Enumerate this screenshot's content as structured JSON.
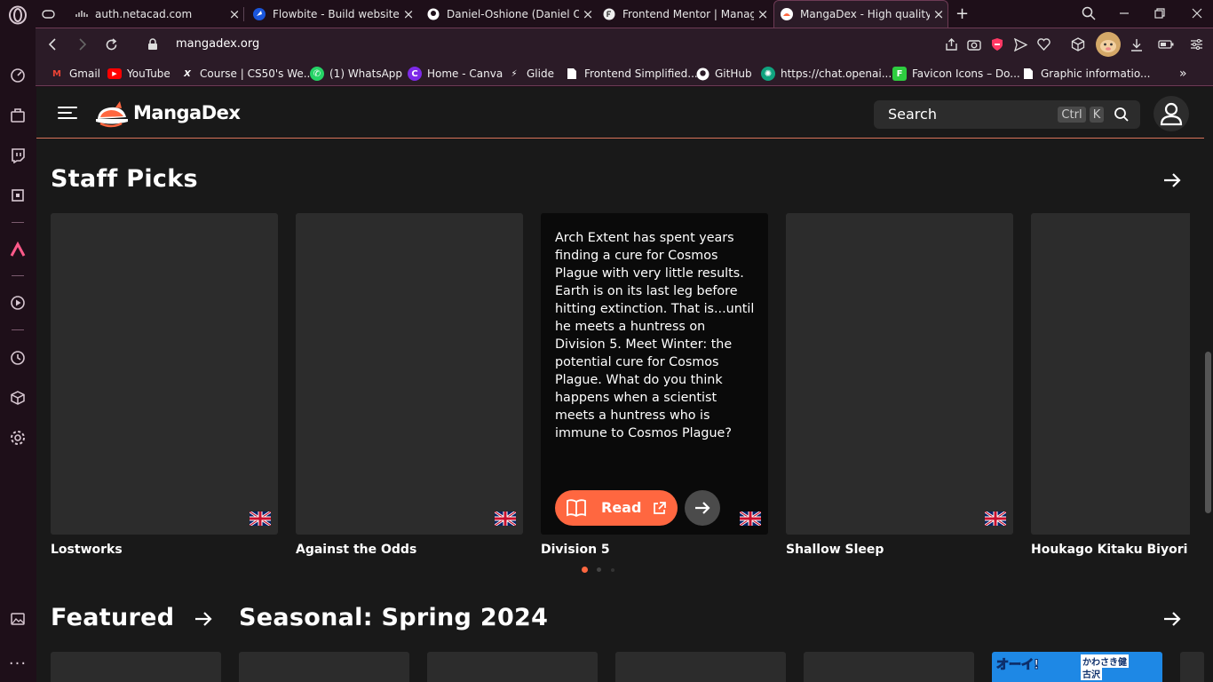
{
  "browser": {
    "tabs": [
      {
        "title": "",
        "favicon": "gamepad-icon"
      },
      {
        "title": "auth.netacad.com",
        "favicon": "cisco-icon"
      },
      {
        "title": "Flowbite - Build websites ev",
        "favicon": "flowbite-icon"
      },
      {
        "title": "Daniel-Oshione (Daniel Osh",
        "favicon": "github-icon"
      },
      {
        "title": "Frontend Mentor | Manage",
        "favicon": "frontend-mentor-icon"
      },
      {
        "title": "MangaDex - High quality im",
        "favicon": "mangadex-icon"
      }
    ],
    "url": "mangadex.org",
    "bookmarks": [
      {
        "label": "Gmail",
        "color": "#ea4335"
      },
      {
        "label": "YouTube",
        "color": "#ff0000"
      },
      {
        "label": "Course | CS50's We...",
        "color": "#ffffff"
      },
      {
        "label": "(1) WhatsApp",
        "color": "#25d366"
      },
      {
        "label": "Home - Canva",
        "color": "#00c4cc"
      },
      {
        "label": "Glide",
        "color": "#ffffff"
      },
      {
        "label": "Frontend Simplified...",
        "color": "#ffffff"
      },
      {
        "label": "GitHub",
        "color": "#ffffff"
      },
      {
        "label": "https://chat.openai....",
        "color": "#10a37f"
      },
      {
        "label": "Favicon Icons – Do...",
        "color": "#2ecc40"
      },
      {
        "label": "Graphic informatio...",
        "color": "#ffffff"
      }
    ]
  },
  "site": {
    "brand": "MangaDex",
    "search_label": "Search",
    "kbd_ctrl": "Ctrl",
    "kbd_k": "K",
    "accent": "#ff6740"
  },
  "staff_picks": {
    "title": "Staff Picks",
    "cards": [
      {
        "title": "Lostworks"
      },
      {
        "title": "Against the Odds"
      },
      {
        "title": "Division 5",
        "description": "Arch Extent has spent years finding a cure for Cosmos Plague with very little results. Earth is on its last leg before hitting extinction. That is...until he meets a huntress on Division 5. Meet Winter: the potential cure for Cosmos Plague. What do you think happens when a scientist meets a huntress who is immune to Cosmos Plague?"
      },
      {
        "title": "Shallow Sleep"
      },
      {
        "title": "Houkago Kitaku Biyori"
      }
    ],
    "read_label": "Read"
  },
  "featured": {
    "title": "Featured"
  },
  "seasonal": {
    "title": "Seasonal: Spring 2024",
    "cover_text_1": "オーイ!",
    "cover_text_2": "かわさき健",
    "cover_text_3": "古沢"
  }
}
